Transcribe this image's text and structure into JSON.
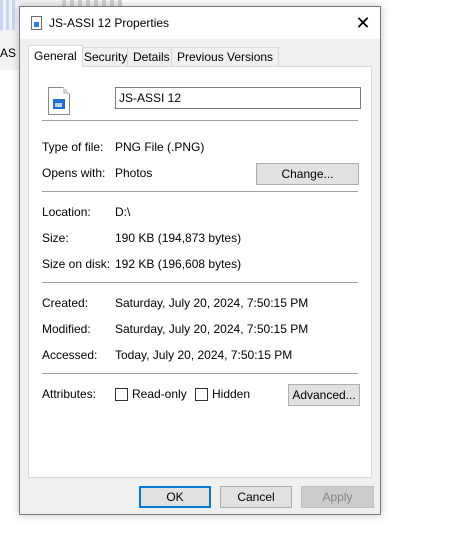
{
  "background": {
    "label": "AS"
  },
  "dialog": {
    "title": "JS-ASSI 12 Properties",
    "close_symbol": "✕",
    "tabs": [
      {
        "label": "General",
        "active": true
      },
      {
        "label": "Security"
      },
      {
        "label": "Details"
      },
      {
        "label": "Previous Versions"
      }
    ],
    "general": {
      "file_name": "JS-ASSI 12",
      "type_of_file_label": "Type of file:",
      "type_of_file_value": "PNG File (.PNG)",
      "opens_with_label": "Opens with:",
      "opens_with_value": "Photos",
      "change_button": "Change...",
      "location_label": "Location:",
      "location_value": "D:\\",
      "size_label": "Size:",
      "size_value": "190 KB (194,873 bytes)",
      "size_on_disk_label": "Size on disk:",
      "size_on_disk_value": "192 KB (196,608 bytes)",
      "created_label": "Created:",
      "created_value": "Saturday, July 20, 2024, 7:50:15 PM",
      "modified_label": "Modified:",
      "modified_value": "Saturday, July 20, 2024, 7:50:15 PM",
      "accessed_label": "Accessed:",
      "accessed_value": "Today, July 20, 2024, 7:50:15 PM",
      "attributes_label": "Attributes:",
      "readonly_label": "Read-only",
      "readonly_checked": false,
      "hidden_label": "Hidden",
      "hidden_checked": false,
      "advanced_button": "Advanced..."
    },
    "buttons": {
      "ok": "OK",
      "cancel": "Cancel",
      "apply": "Apply"
    }
  },
  "colors": {
    "accent": "#0078d7",
    "dialog_bg": "#f0f0f0",
    "panel_bg": "#ffffff"
  }
}
